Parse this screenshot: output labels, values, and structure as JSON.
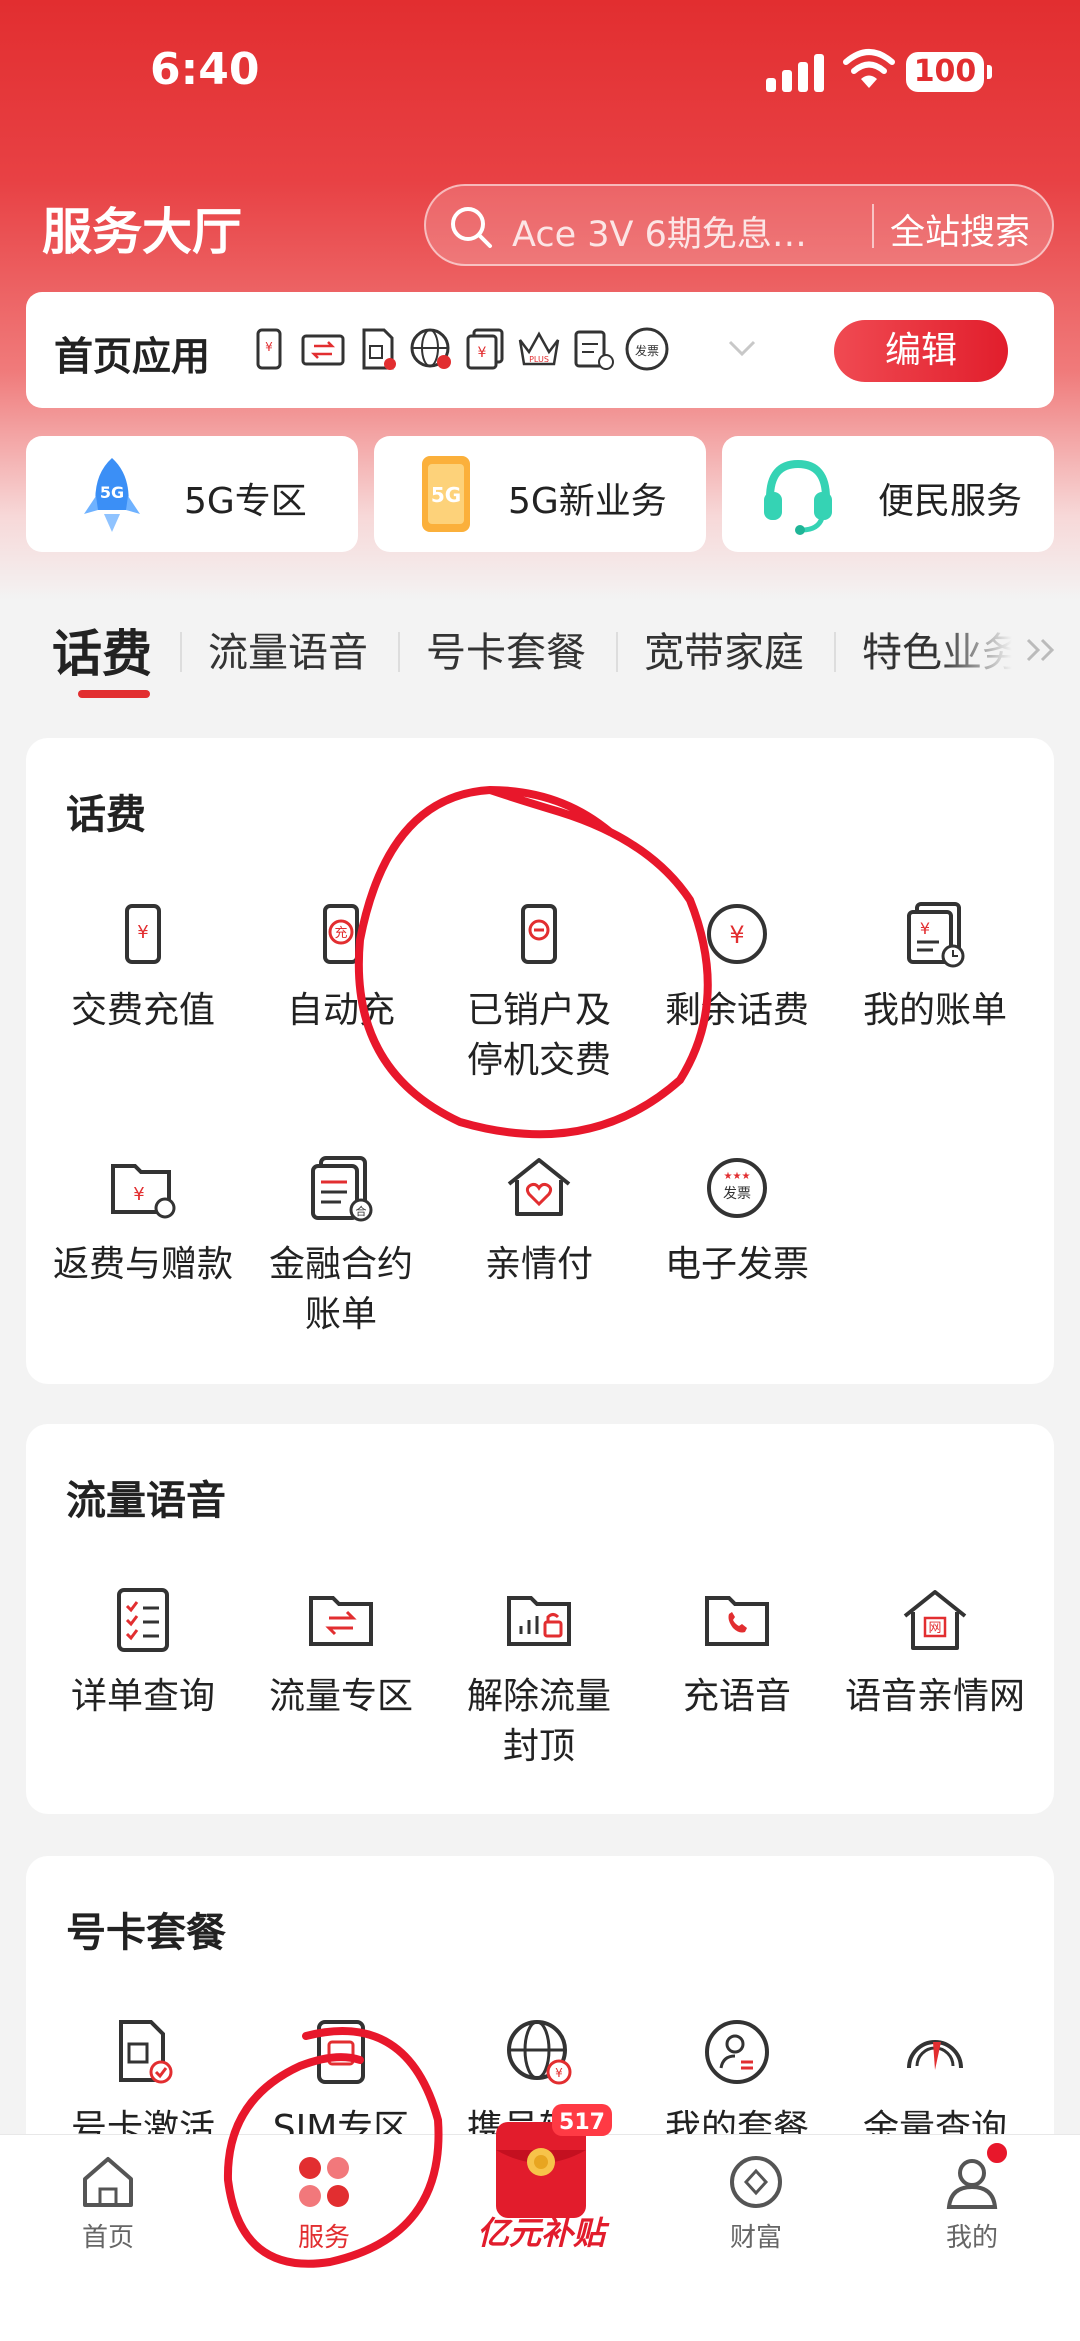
{
  "status": {
    "time": "6:40",
    "battery": "100"
  },
  "header": {
    "title": "服务大厅",
    "search_placeholder": "Ace 3V 6期免息…",
    "search_button": "全站搜索"
  },
  "apps_bar": {
    "label": "首页应用",
    "edit": "编辑",
    "icons": [
      "phone-yuan-icon",
      "transfer-icon",
      "sim-icon",
      "globe-icon",
      "bill-yuan-icon",
      "crown-plus-icon",
      "receipt-icon",
      "invoice-icon"
    ],
    "plus_text": "PLUS",
    "invoice_text": "发票"
  },
  "quick": [
    {
      "label": "5G专区",
      "icon": "rocket-5g-icon",
      "badge": "5G"
    },
    {
      "label": "5G新业务",
      "icon": "phone-5g-icon",
      "badge": "5G"
    },
    {
      "label": "便民服务",
      "icon": "headset-icon"
    }
  ],
  "tabs": [
    "话费",
    "流量语音",
    "号卡套餐",
    "宽带家庭",
    "特色业务"
  ],
  "sections": {
    "fee": {
      "title": "话费",
      "items": [
        {
          "label": "交费充值",
          "icon": "phone-yuan-icon"
        },
        {
          "label": "自动充",
          "icon": "auto-recharge-icon",
          "glyph": "充"
        },
        {
          "label": "已销户及\n停机交费",
          "icon": "phone-minus-icon"
        },
        {
          "label": "剩余话费",
          "icon": "coin-yuan-icon"
        },
        {
          "label": "我的账单",
          "icon": "bill-clock-icon"
        },
        {
          "label": "返费与赠款",
          "icon": "refund-folder-icon"
        },
        {
          "label": "金融合约\n账单",
          "icon": "contract-bill-icon",
          "glyph": "合"
        },
        {
          "label": "亲情付",
          "icon": "home-heart-icon"
        },
        {
          "label": "电子发票",
          "icon": "e-invoice-icon",
          "glyph": "发票"
        }
      ]
    },
    "traffic": {
      "title": "流量语音",
      "items": [
        {
          "label": "详单查询",
          "icon": "checklist-icon"
        },
        {
          "label": "流量专区",
          "icon": "traffic-folder-icon"
        },
        {
          "label": "解除流量\n封顶",
          "icon": "unlock-traffic-icon"
        },
        {
          "label": "充语音",
          "icon": "voice-folder-icon"
        },
        {
          "label": "语音亲情网",
          "icon": "family-net-icon",
          "glyph": "网"
        }
      ]
    },
    "card": {
      "title": "号卡套餐",
      "items": [
        {
          "label": "号卡激活",
          "icon": "sim-check-icon"
        },
        {
          "label": "SIM专区",
          "icon": "sim-card-icon"
        },
        {
          "label": "携号转网",
          "icon": "globe-yuan-icon"
        },
        {
          "label": "我的套餐",
          "icon": "user-package-icon"
        },
        {
          "label": "余量查询",
          "icon": "gauge-icon"
        }
      ]
    }
  },
  "nav": [
    {
      "label": "首页",
      "icon": "home-icon"
    },
    {
      "label": "服务",
      "icon": "service-clover-icon"
    },
    {
      "label": "亿元补贴",
      "icon": "red-envelope-icon",
      "badge": "517"
    },
    {
      "label": "财富",
      "icon": "wealth-icon"
    },
    {
      "label": "我的",
      "icon": "profile-icon"
    }
  ],
  "colors": {
    "brand": "#e22e30",
    "accent": "#e11e2c",
    "annotation": "#e8172b"
  }
}
